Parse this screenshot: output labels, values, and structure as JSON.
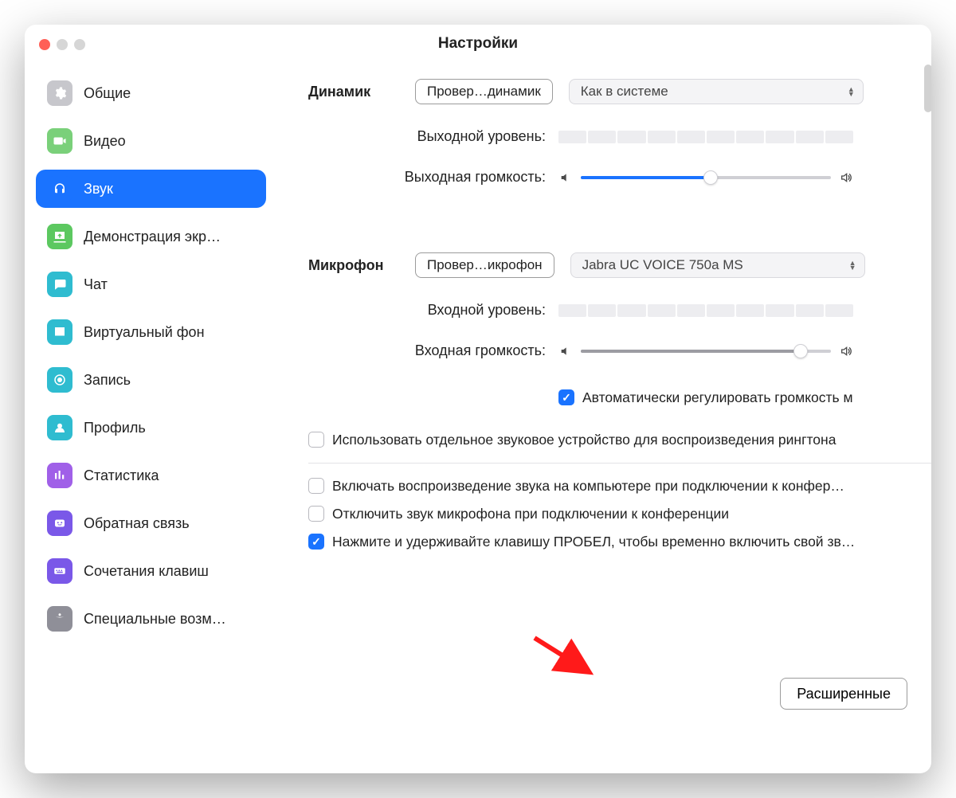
{
  "window": {
    "title": "Настройки"
  },
  "sidebar": {
    "items": [
      {
        "label": "Общие",
        "icon": "gear-icon"
      },
      {
        "label": "Видео",
        "icon": "video-icon"
      },
      {
        "label": "Звук",
        "icon": "headphones-icon"
      },
      {
        "label": "Демонстрация экр…",
        "icon": "share-screen-icon"
      },
      {
        "label": "Чат",
        "icon": "chat-icon"
      },
      {
        "label": "Виртуальный фон",
        "icon": "virtual-background-icon"
      },
      {
        "label": "Запись",
        "icon": "record-icon"
      },
      {
        "label": "Профиль",
        "icon": "profile-icon"
      },
      {
        "label": "Статистика",
        "icon": "stats-icon"
      },
      {
        "label": "Обратная связь",
        "icon": "feedback-icon"
      },
      {
        "label": "Сочетания клавиш",
        "icon": "keyboard-icon"
      },
      {
        "label": "Специальные возм…",
        "icon": "accessibility-icon"
      }
    ],
    "active_index": 2
  },
  "audio": {
    "speaker": {
      "section_label": "Динамик",
      "test_button": "Провер…динамик",
      "device_selected": "Как в системе",
      "output_level_label": "Выходной уровень:",
      "output_volume_label": "Выходная громкость:",
      "output_volume_percent": 52
    },
    "microphone": {
      "section_label": "Микрофон",
      "test_button": "Провер…икрофон",
      "device_selected": "Jabra UC VOICE 750a MS",
      "input_level_label": "Входной уровень:",
      "input_volume_label": "Входная громкость:",
      "input_volume_percent": 88,
      "auto_adjust_checked": true,
      "auto_adjust_label": "Автоматически регулировать громкость м"
    },
    "separate_ringtone": {
      "checked": false,
      "label": "Использовать отдельное звуковое устройство для воспроизведения рингтона"
    },
    "options": [
      {
        "checked": false,
        "label": "Включать воспроизведение звука на компьютере при подключении к конфер…"
      },
      {
        "checked": false,
        "label": "Отключить звук микрофона при подключении к конференции"
      },
      {
        "checked": true,
        "label": "Нажмите и удерживайте клавишу ПРОБЕЛ, чтобы временно включить свой зв…"
      }
    ],
    "advanced_button": "Расширенные"
  }
}
